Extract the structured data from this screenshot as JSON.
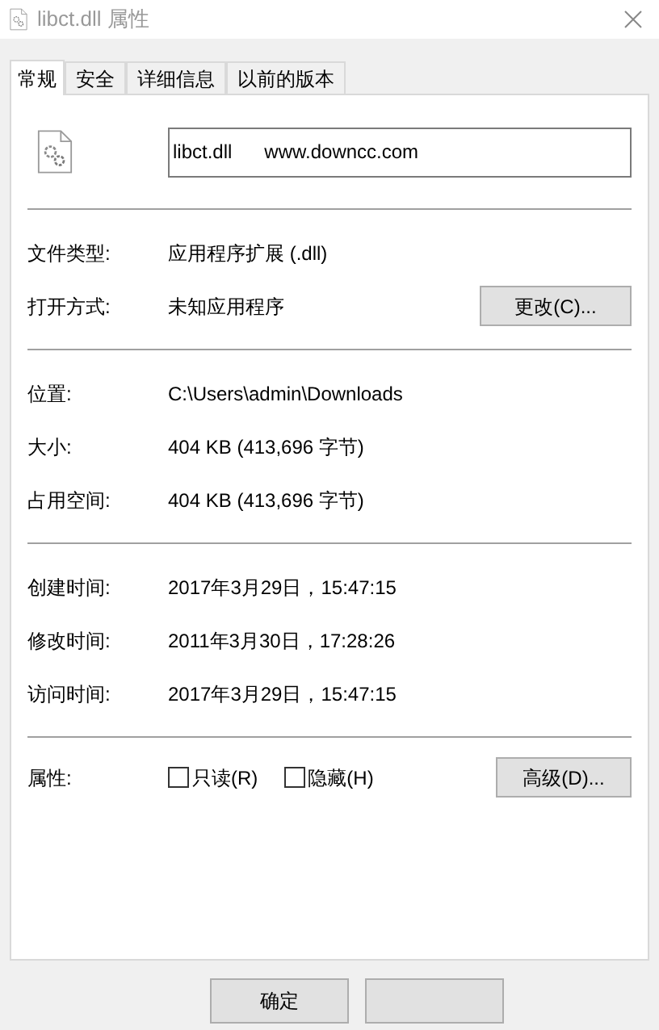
{
  "window": {
    "title": "libct.dll 属性"
  },
  "tabs": [
    {
      "label": "常规",
      "selected": true
    },
    {
      "label": "安全",
      "selected": false
    },
    {
      "label": "详细信息",
      "selected": false
    },
    {
      "label": "以前的版本",
      "selected": false
    }
  ],
  "name_field": {
    "value": "libct.dll      www.downcc.com"
  },
  "groups": [
    [
      {
        "label": "文件类型:",
        "value": "应用程序扩展 (.dll)"
      },
      {
        "label": "打开方式:",
        "value": "未知应用程序",
        "button": "更改(C)..."
      }
    ],
    [
      {
        "label": "位置:",
        "value": "C:\\Users\\admin\\Downloads"
      },
      {
        "label": "大小:",
        "value": "404 KB (413,696 字节)"
      },
      {
        "label": "占用空间:",
        "value": "404 KB (413,696 字节)"
      }
    ],
    [
      {
        "label": "创建时间:",
        "value": "2017年3月29日，15:47:15"
      },
      {
        "label": "修改时间:",
        "value": "2011年3月30日，17:28:26"
      },
      {
        "label": "访问时间:",
        "value": "2017年3月29日，15:47:15"
      }
    ]
  ],
  "attributes": {
    "label": "属性:",
    "checkboxes": [
      {
        "label": "只读(R)",
        "checked": false
      },
      {
        "label": "隐藏(H)",
        "checked": false
      }
    ],
    "button": "高级(D)..."
  },
  "buttons": [
    "确定"
  ]
}
